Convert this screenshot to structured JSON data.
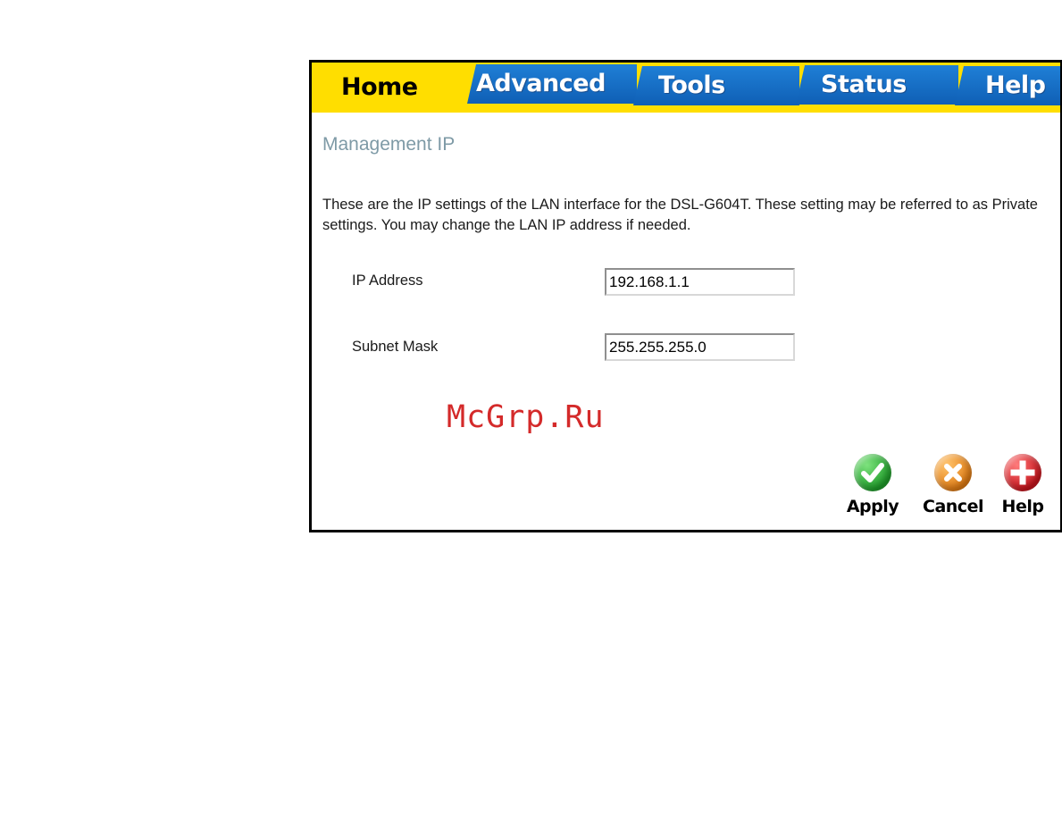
{
  "nav": {
    "tabs": [
      {
        "label": "Home",
        "active": true
      },
      {
        "label": "Advanced",
        "active": false
      },
      {
        "label": "Tools",
        "active": false
      },
      {
        "label": "Status",
        "active": false
      },
      {
        "label": "Help",
        "active": false
      }
    ]
  },
  "page": {
    "title": "Management IP",
    "description": "These are the IP settings of the LAN interface for the DSL-G604T. These setting may be referred to as Private settings. You may change the LAN IP address if needed."
  },
  "form": {
    "ip_address": {
      "label": "IP Address",
      "value": "192.168.1.1"
    },
    "subnet_mask": {
      "label": "Subnet Mask",
      "value": "255.255.255.0"
    }
  },
  "watermark": "McGrp.Ru",
  "actions": {
    "apply_label": "Apply",
    "cancel_label": "Cancel",
    "help_label": "Help"
  },
  "colors": {
    "tabbar_yellow": "#ffde00",
    "tab_blue": "#1f7fd6",
    "title_gray": "#7e9aa6",
    "watermark_red": "#d42a2a",
    "apply_green": "#1f9e2a",
    "cancel_orange": "#e07b13",
    "help_red": "#c8141c"
  },
  "icons": {
    "apply": "check-icon",
    "cancel": "x-icon",
    "help": "plus-icon"
  }
}
